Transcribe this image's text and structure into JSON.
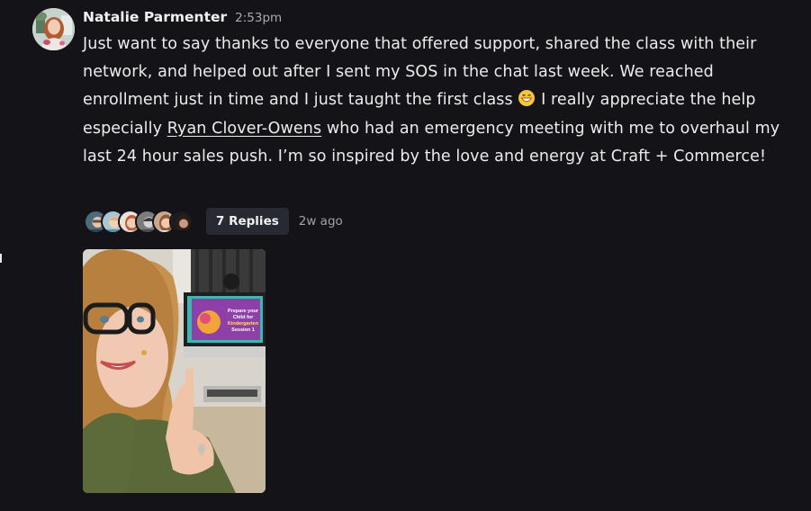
{
  "post": {
    "author": "Natalie Parmenter",
    "time": "2:53pm",
    "text_before_emoji": "Just want to say thanks to everyone that offered support, shared the class with their network, and helped out after I sent my SOS in the chat last week. We reached enrollment just in time and I just taught the first class",
    "text_after_emoji_pre": " I really appreciate the help especially ",
    "mention": "Ryan Clover-Owens",
    "text_after_mention": " who had an emergency meeting with me to overhaul my last 24 hour sales push. I’m so inspired by the love and energy at Craft + Commerce!",
    "emoji": "grinning-face-emoji"
  },
  "thread": {
    "replies_label": "7 Replies",
    "ago": "2w ago",
    "avatar_count": 6
  },
  "attachment": {
    "screen_text": "Prepare your Child for Kindergarten Session 1"
  },
  "colors": {
    "background": "#141318",
    "text": "#ececec",
    "muted": "#a9a9b0",
    "replies_bg": "#272a33"
  }
}
